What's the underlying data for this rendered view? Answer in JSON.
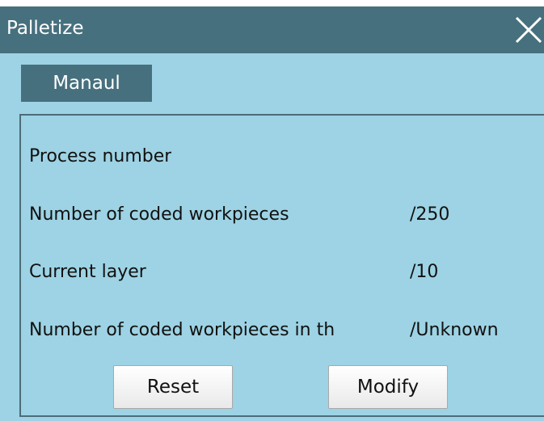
{
  "window": {
    "title": "Palletize",
    "close_icon": "close-icon"
  },
  "mode_tab": {
    "label": "Manaul"
  },
  "rows": [
    {
      "label": "Process number",
      "value": ""
    },
    {
      "label": "Number of coded workpieces",
      "value": "/250"
    },
    {
      "label": "Current layer",
      "value": "/10"
    },
    {
      "label": "Number of coded workpieces in th",
      "value": "/Unknown"
    }
  ],
  "buttons": {
    "reset": "Reset",
    "modify": "Modify"
  },
  "colors": {
    "titlebar": "#47707e",
    "background": "#9dd3e4",
    "tab": "#47707e",
    "panel_border": "#4b6c78"
  }
}
